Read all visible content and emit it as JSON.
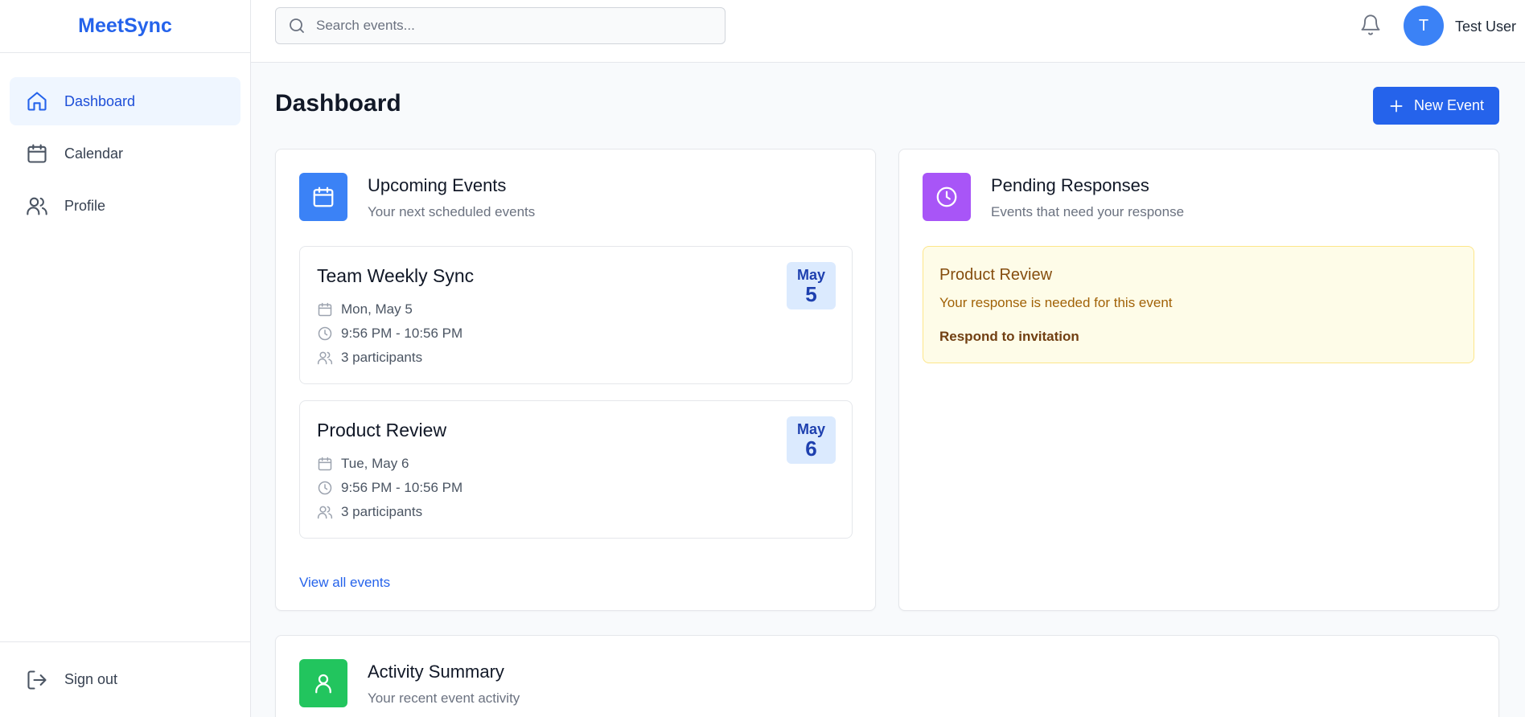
{
  "app": {
    "brand": "MeetSync"
  },
  "sidebar": {
    "items": [
      {
        "label": "Dashboard",
        "icon": "home-icon",
        "active": true
      },
      {
        "label": "Calendar",
        "icon": "calendar-icon",
        "active": false
      },
      {
        "label": "Profile",
        "icon": "users-icon",
        "active": false
      }
    ],
    "signout_label": "Sign out"
  },
  "header": {
    "search_placeholder": "Search events...",
    "user_initial": "T",
    "user_name": "Test User"
  },
  "page": {
    "title": "Dashboard",
    "new_event_label": "New Event"
  },
  "upcoming": {
    "title": "Upcoming Events",
    "subtitle": "Your next scheduled events",
    "icon_color": "#3b82f6",
    "events": [
      {
        "title": "Team Weekly Sync",
        "date": "Mon, May 5",
        "time": "9:56 PM - 10:56 PM",
        "participants": "3 participants",
        "badge_month": "May",
        "badge_day": "5"
      },
      {
        "title": "Product Review",
        "date": "Tue, May 6",
        "time": "9:56 PM - 10:56 PM",
        "participants": "3 participants",
        "badge_month": "May",
        "badge_day": "6"
      }
    ],
    "view_all_label": "View all events"
  },
  "pending": {
    "title": "Pending Responses",
    "subtitle": "Events that need your response",
    "icon_color": "#a855f7",
    "item": {
      "title": "Product Review",
      "text": "Your response is needed for this event",
      "link": "Respond to invitation"
    }
  },
  "activity": {
    "title": "Activity Summary",
    "subtitle": "Your recent event activity",
    "icon_color": "#22c55e"
  },
  "colors": {
    "accent": "#2563eb",
    "active_nav_bg": "#eff6ff"
  }
}
